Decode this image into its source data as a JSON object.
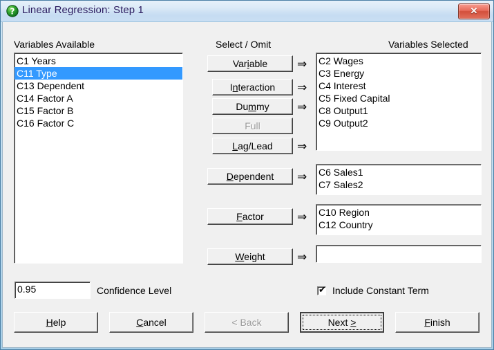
{
  "window": {
    "title": "Linear Regression: Step 1",
    "icon": "question-mark-icon",
    "close_label": "✕",
    "accent_title_text_color": "#2a1a5e",
    "selection_color": "#3399ff",
    "close_button_color": "#d24f3b"
  },
  "panels": {
    "available": {
      "heading": "Variables Available",
      "items": [
        {
          "label": "C1 Years",
          "selected": false
        },
        {
          "label": "C11 Type",
          "selected": true
        },
        {
          "label": "C13 Dependent",
          "selected": false
        },
        {
          "label": "C14 Factor A",
          "selected": false
        },
        {
          "label": "C15 Factor B",
          "selected": false
        },
        {
          "label": "C16 Factor C",
          "selected": false
        }
      ]
    },
    "middle": {
      "heading": "Select / Omit"
    },
    "selected": {
      "heading": "Variables Selected",
      "items": [
        {
          "label": "C2 Wages"
        },
        {
          "label": "C3 Energy"
        },
        {
          "label": "C4 Interest"
        },
        {
          "label": "C5 Fixed Capital"
        },
        {
          "label": "C8 Output1"
        },
        {
          "label": "C9 Output2"
        }
      ]
    },
    "dependent": {
      "items": [
        {
          "label": "C6 Sales1"
        },
        {
          "label": "C7 Sales2"
        }
      ]
    },
    "factor": {
      "items": [
        {
          "label": "C10 Region"
        },
        {
          "label": "C12 Country"
        }
      ]
    },
    "weight": {
      "items": []
    }
  },
  "transfer_buttons": [
    {
      "name": "variable",
      "label": "Variable",
      "mnemonic": "i",
      "enabled": true,
      "arrow": "⇒"
    },
    {
      "name": "interaction",
      "label": "Interaction",
      "mnemonic": "n",
      "enabled": true,
      "arrow": "⇒"
    },
    {
      "name": "dummy",
      "label": "Dummy",
      "mnemonic": "m",
      "enabled": true,
      "arrow": "⇒"
    },
    {
      "name": "full",
      "label": "Full",
      "mnemonic": "F",
      "enabled": false,
      "arrow": ""
    },
    {
      "name": "lag-lead",
      "label": "Lag/Lead",
      "mnemonic": "L",
      "enabled": true,
      "arrow": "⇒"
    },
    {
      "name": "dependent",
      "label": "Dependent",
      "mnemonic": "D",
      "enabled": true,
      "arrow": "⇒"
    },
    {
      "name": "factor",
      "label": "Factor",
      "mnemonic": "F",
      "enabled": true,
      "arrow": "⇒"
    },
    {
      "name": "weight",
      "label": "Weight",
      "mnemonic": "W",
      "enabled": true,
      "arrow": "⇒"
    }
  ],
  "options": {
    "confidence_level_value": "0.95",
    "confidence_level_label": "Confidence Level",
    "include_constant_label": "Include Constant Term",
    "include_constant_checked": true,
    "check_glyph": "✔"
  },
  "footer_buttons": {
    "help": {
      "label": "Help",
      "enabled": true
    },
    "cancel": {
      "label": "Cancel",
      "enabled": true
    },
    "back": {
      "label": "< Back",
      "enabled": false
    },
    "next": {
      "label": "Next >",
      "enabled": true,
      "is_default": true
    },
    "finish": {
      "label": "Finish",
      "enabled": true
    }
  }
}
